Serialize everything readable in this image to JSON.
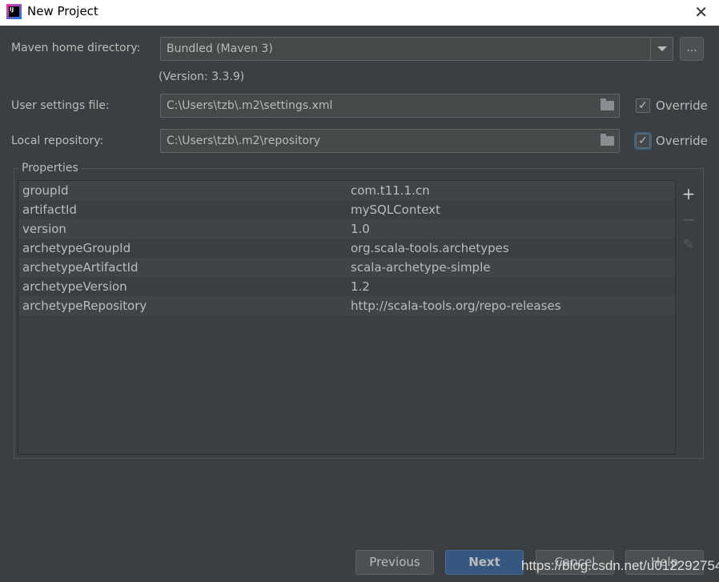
{
  "window": {
    "title": "New Project",
    "close": "✕"
  },
  "maven_home": {
    "label": "Maven home directory:",
    "value": "Bundled (Maven 3)",
    "browse": "...",
    "version": "(Version: 3.3.9)"
  },
  "user_settings": {
    "label": "User settings file:",
    "value": "C:\\Users\\tzb\\.m2\\settings.xml",
    "override_label": "Override",
    "override_checked": true
  },
  "local_repo": {
    "label": "Local repository:",
    "value": "C:\\Users\\tzb\\.m2\\repository",
    "override_label": "Override",
    "override_checked": true
  },
  "properties": {
    "title": "Properties",
    "rows": [
      {
        "key": "groupId",
        "value": "com.t11.1.cn"
      },
      {
        "key": "artifactId",
        "value": "mySQLContext"
      },
      {
        "key": "version",
        "value": "1.0"
      },
      {
        "key": "archetypeGroupId",
        "value": "org.scala-tools.archetypes"
      },
      {
        "key": "archetypeArtifactId",
        "value": "scala-archetype-simple"
      },
      {
        "key": "archetypeVersion",
        "value": "1.2"
      },
      {
        "key": "archetypeRepository",
        "value": "http://scala-tools.org/repo-releases"
      }
    ],
    "add": "+",
    "remove": "−",
    "edit": "✎"
  },
  "buttons": {
    "previous": "Previous",
    "next": "Next",
    "cancel": "Cancel",
    "help": "Help"
  },
  "watermark": "https://blog.csdn.net/u012292754",
  "colors": {
    "background": "#3c3f41",
    "primary_button": "#365880",
    "focus": "#3d6185"
  }
}
